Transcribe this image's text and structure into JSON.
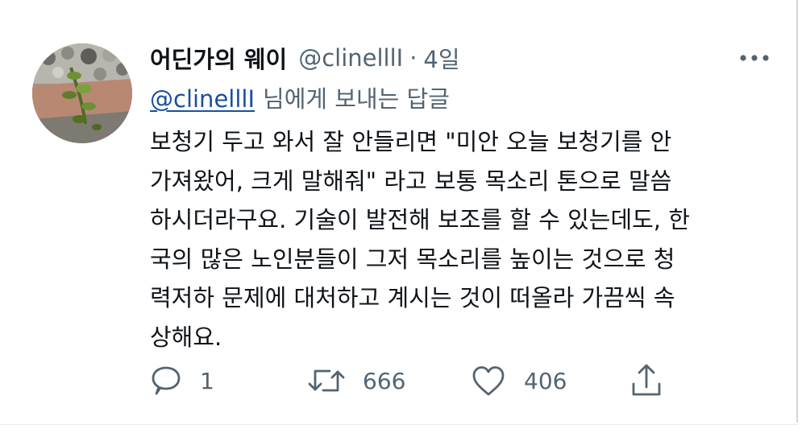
{
  "tweet": {
    "display_name": "어딘가의 웨이",
    "handle": "@clinelllI",
    "separator": "·",
    "time_ago": "4일",
    "more_icon": "more-horizontal-icon",
    "reply_to": {
      "mention": "@clinelllI",
      "suffix": "님에게 보내는 답글"
    },
    "body_lines": [
      "보청기 두고 와서 잘 안들리면 \"미안 오늘 보청기를 안",
      "가져왔어, 크게 말해줘\" 라고 보통 목소리 톤으로 말씀",
      "하시더라구요. 기술이 발전해 보조를 할 수 있는데도, 한",
      "국의 많은 노인분들이 그저 목소리를 높이는 것으로 청",
      "력저하 문제에 대처하고 계시는 것이 떠올라 가끔씩 속",
      "상해요."
    ],
    "actions": {
      "reply": {
        "icon": "reply-icon",
        "count": "1"
      },
      "retweet": {
        "icon": "retweet-icon",
        "count": "666"
      },
      "like": {
        "icon": "heart-icon",
        "count": "406"
      },
      "share": {
        "icon": "share-icon"
      }
    }
  },
  "colors": {
    "text_primary": "#0f1419",
    "text_secondary": "#536471",
    "mention_link": "#1b4f9c"
  }
}
